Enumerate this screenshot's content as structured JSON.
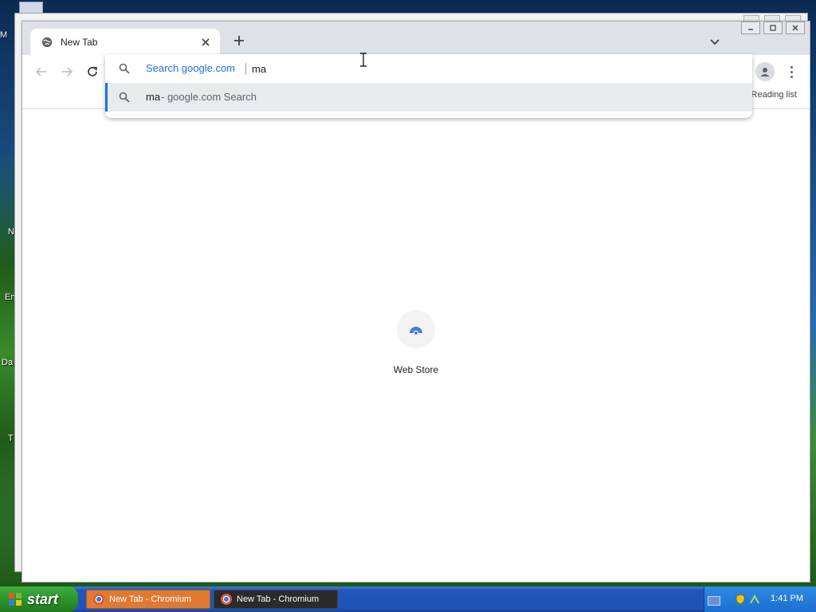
{
  "desktop": {
    "labels": [
      "M",
      "N",
      "En",
      "Da",
      "T"
    ]
  },
  "browser": {
    "tab": {
      "title": "New Tab",
      "icon": "globe-icon"
    },
    "icons": {
      "new_tab": "plus-icon",
      "tab_search": "chevron-down-icon",
      "back": "back-arrow-icon",
      "forward": "forward-arrow-icon",
      "reload": "reload-icon",
      "profile": "person-icon",
      "menu": "kebab-menu-icon",
      "search": "search-icon"
    },
    "omnibox": {
      "keyword_label": "Search google.com",
      "input_value": "ma",
      "suggestion": {
        "query": "ma",
        "description": "- google.com Search"
      }
    },
    "bookmarks_bar": {
      "reading_list": "Reading list"
    },
    "ntp": {
      "shortcuts": [
        {
          "label": "Web Store",
          "icon": "web-store-icon"
        }
      ]
    }
  },
  "taskbar": {
    "start_label": "start",
    "buttons": [
      {
        "label": "New Tab - Chromium",
        "active": true
      },
      {
        "label": "New Tab - Chromium",
        "active": false
      }
    ],
    "tray": {
      "clock": "1:41 PM",
      "icons": [
        "keyboard-icon",
        "shield-icon",
        "network-icon"
      ]
    }
  },
  "colors": {
    "accent": "#1a73e8",
    "tab_strip": "#dee1e6",
    "suggestion_bg": "#e8eaed",
    "taskbar_blue": "#2156bd",
    "start_green": "#2a8f2a",
    "taskbtn_orange": "#e07a33",
    "taskbtn_dark": "#2b2b2b"
  }
}
